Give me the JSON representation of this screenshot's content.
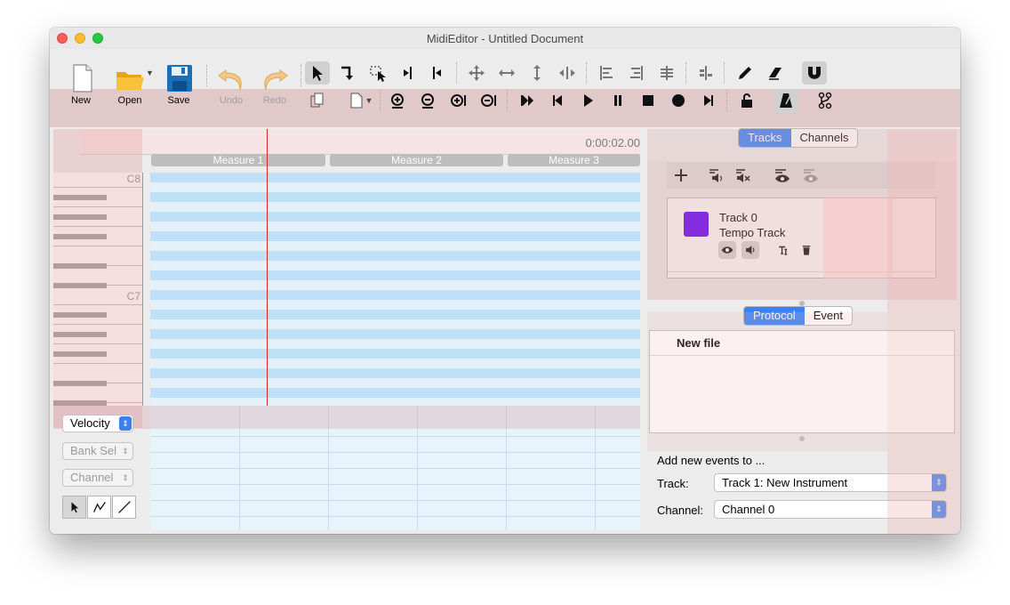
{
  "window": {
    "title": "MidiEditor - Untitled Document"
  },
  "toolbar": {
    "new_label": "New",
    "open_label": "Open",
    "save_label": "Save",
    "undo_label": "Undo",
    "redo_label": "Redo"
  },
  "ruler": {
    "time": "0:00:02.00",
    "measures": [
      "Measure 1",
      "Measure 2",
      "Measure 3"
    ]
  },
  "piano": {
    "labels": [
      "C8",
      "C7"
    ]
  },
  "lower_controls": {
    "velocity": "Velocity",
    "bank_select": "Bank Sel",
    "channel": "Channel"
  },
  "tabs_top": {
    "tracks": "Tracks",
    "channels": "Channels"
  },
  "tracks": [
    {
      "name": "Track 0",
      "subtitle": "Tempo Track",
      "color": "#6200ff"
    }
  ],
  "tabs_bottom": {
    "protocol": "Protocol",
    "event": "Event"
  },
  "protocol": {
    "entry": "New file"
  },
  "add_events": {
    "heading": "Add new events to ...",
    "track_label": "Track:",
    "track_value": "Track 1: New Instrument",
    "channel_label": "Channel:",
    "channel_value": "Channel 0"
  },
  "colors": {
    "accent": "#3b82f6",
    "playhead": "#d62a2a",
    "grid_row": "#bfe1f7"
  }
}
